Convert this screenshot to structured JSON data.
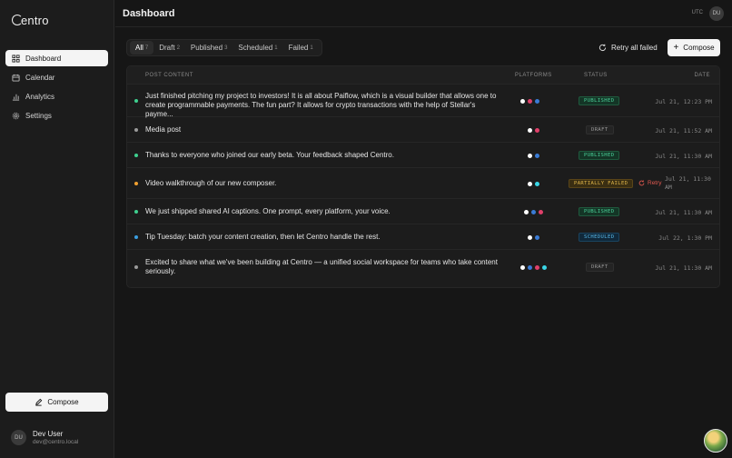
{
  "app": {
    "logo_text": "entro"
  },
  "sidebar": {
    "items": [
      {
        "label": "Dashboard",
        "icon": "grid-icon",
        "active": true
      },
      {
        "label": "Calendar",
        "icon": "calendar-icon",
        "active": false
      },
      {
        "label": "Analytics",
        "icon": "bar-chart-icon",
        "active": false
      },
      {
        "label": "Settings",
        "icon": "gear-icon",
        "active": false
      }
    ],
    "compose_label": "Compose",
    "user": {
      "initials": "DU",
      "name": "Dev User",
      "email": "dev@centro.local"
    }
  },
  "header": {
    "title": "Dashboard",
    "timezone": "UTC",
    "avatar_initials": "DU"
  },
  "toolbar": {
    "tabs": [
      {
        "label": "All",
        "count": "7",
        "active": true
      },
      {
        "label": "Draft",
        "count": "2",
        "active": false
      },
      {
        "label": "Published",
        "count": "3",
        "active": false
      },
      {
        "label": "Scheduled",
        "count": "1",
        "active": false
      },
      {
        "label": "Failed",
        "count": "1",
        "active": false
      }
    ],
    "retry_all_label": "Retry all failed",
    "compose_label": "Compose"
  },
  "table": {
    "columns": {
      "content": "Post Content",
      "platforms": "Platforms",
      "status": "Status",
      "date": "Date"
    },
    "retry_label": "Retry",
    "rows": [
      {
        "dot_color": "#3ecf8e",
        "content_line1": "Just finished pitching my project to investors! It is all about Paiflow, which is a visual builder that allows one to",
        "content_line2": "create programmable payments. The fun part? It allows for crypto transactions with the help of Stellar's payme...",
        "platforms": [
          "#ffffff",
          "#e0406a",
          "#3a7bd5"
        ],
        "status": "PUBLISHED",
        "status_kind": "published",
        "date": "Jul 21, 12:23 PM"
      },
      {
        "dot_color": "#9a9a9a",
        "content_line1": "Media post",
        "content_line2": "",
        "platforms": [
          "#ffffff",
          "#e0406a"
        ],
        "status": "DRAFT",
        "status_kind": "draft",
        "date": "Jul 21, 11:52 AM"
      },
      {
        "dot_color": "#3ecf8e",
        "content_line1": "Thanks to everyone who joined our early beta. Your feedback shaped Centro.",
        "content_line2": "",
        "platforms": [
          "#ffffff",
          "#3a7bd5"
        ],
        "status": "PUBLISHED",
        "status_kind": "published",
        "date": "Jul 21, 11:30 AM"
      },
      {
        "dot_color": "#f0a030",
        "content_line1": "Video walkthrough of our new composer.",
        "content_line2": "",
        "platforms": [
          "#ffffff",
          "#3ad6e6"
        ],
        "status": "PARTIALLY FAILED",
        "status_kind": "partial",
        "date_line1": "Jul 21, 11:30",
        "date_line2": "AM",
        "has_retry": true
      },
      {
        "dot_color": "#3ecf8e",
        "content_line1": "We just shipped shared AI captions. One prompt, every platform, your voice.",
        "content_line2": "",
        "platforms": [
          "#ffffff",
          "#3a7bd5",
          "#e0406a"
        ],
        "status": "PUBLISHED",
        "status_kind": "published",
        "date": "Jul 21, 11:30 AM"
      },
      {
        "dot_color": "#3a9ee0",
        "content_line1": "Tip Tuesday: batch your content creation, then let Centro handle the rest.",
        "content_line2": "",
        "platforms": [
          "#ffffff",
          "#3a7bd5"
        ],
        "status": "SCHEDULED",
        "status_kind": "scheduled",
        "date": "Jul 22, 1:30 PM"
      },
      {
        "dot_color": "#9a9a9a",
        "content_line1": "Excited to share what we've been building at Centro — a unified social workspace for teams who take content",
        "content_line2": "seriously.",
        "platforms": [
          "#ffffff",
          "#3a7bd5",
          "#e0406a",
          "#3ad6e6"
        ],
        "status": "DRAFT",
        "status_kind": "draft",
        "date": "Jul 21, 11:30 AM"
      }
    ]
  }
}
